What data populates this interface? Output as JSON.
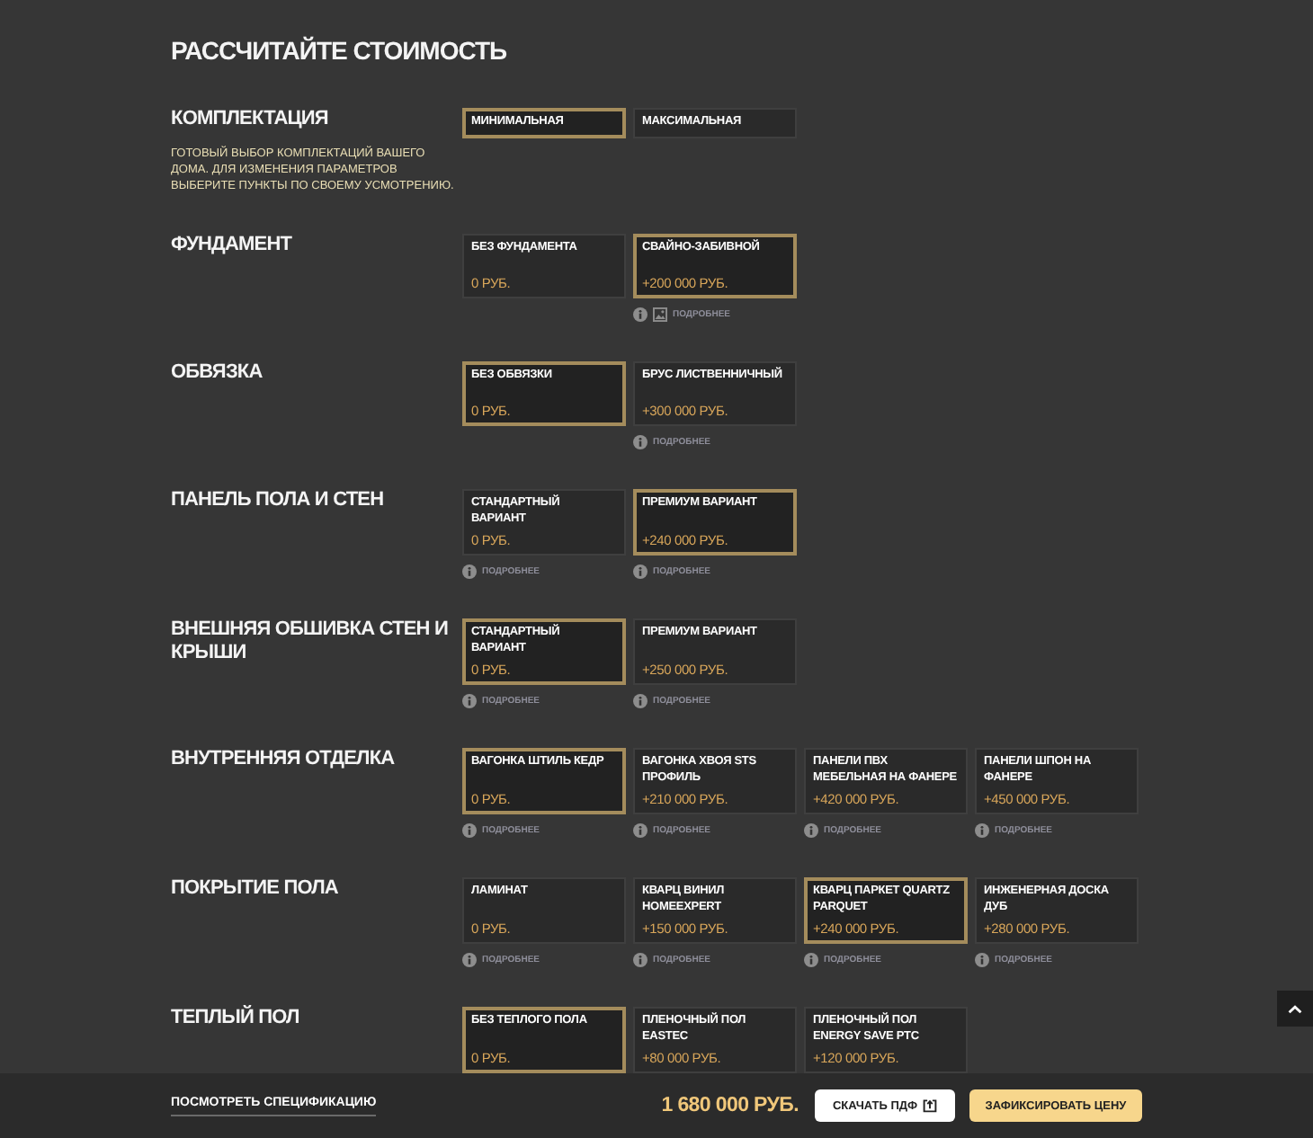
{
  "title": "РАССЧИТАЙТЕ СТОИМОСТЬ",
  "sections": [
    {
      "heading": "КОМПЛЕКТАЦИЯ",
      "description": "ГОТОВЫЙ ВЫБОР КОМПЛЕКТАЦИЙ ВАШЕГО ДОМА. ДЛЯ ИЗМЕНЕНИЯ ПАРАМЕТРОВ ВЫБЕРИТЕ ПУНКТЫ ПО СВОЕМУ УСМОТРЕНИЮ.",
      "options": [
        {
          "title": "МИНИМАЛЬНАЯ",
          "selected": true
        },
        {
          "title": "МАКСИМАЛЬНАЯ",
          "selected": false
        }
      ]
    },
    {
      "heading": "ФУНДАМЕНТ",
      "options": [
        {
          "title": "БЕЗ ФУНДАМЕНТА",
          "price": "0 РУБ.",
          "selected": false
        },
        {
          "title": "СВАЙНО-ЗАБИВНОЙ",
          "price": "+200 000 РУБ.",
          "selected": true,
          "details": "ПОДРОБНЕЕ",
          "has_photo": true
        }
      ]
    },
    {
      "heading": "ОБВЯЗКА",
      "options": [
        {
          "title": "БЕЗ ОБВЯЗКИ",
          "price": "0 РУБ.",
          "selected": true
        },
        {
          "title": "БРУС ЛИСТВЕННИЧНЫЙ",
          "price": "+300 000 РУБ.",
          "selected": false,
          "details": "ПОДРОБНЕЕ",
          "has_photo": false
        }
      ]
    },
    {
      "heading": "ПАНЕЛЬ ПОЛА И СТЕН",
      "options": [
        {
          "title": "СТАНДАРТНЫЙ ВАРИАНТ",
          "price": "0 РУБ.",
          "selected": false,
          "details": "ПОДРОБНЕЕ",
          "has_photo": false
        },
        {
          "title": "ПРЕМИУМ ВАРИАНТ",
          "price": "+240 000 РУБ.",
          "selected": true,
          "details": "ПОДРОБНЕЕ",
          "has_photo": false
        }
      ]
    },
    {
      "heading": "ВНЕШНЯЯ ОБШИВКА СТЕН И КРЫШИ",
      "options": [
        {
          "title": "СТАНДАРТНЫЙ ВАРИАНТ",
          "price": "0 РУБ.",
          "selected": true,
          "details": "ПОДРОБНЕЕ",
          "has_photo": false
        },
        {
          "title": "ПРЕМИУМ ВАРИАНТ",
          "price": "+250 000 РУБ.",
          "selected": false,
          "details": "ПОДРОБНЕЕ",
          "has_photo": false
        }
      ]
    },
    {
      "heading": "ВНУТРЕННЯЯ ОТДЕЛКА",
      "options": [
        {
          "title": "ВАГОНКА ШТИЛЬ КЕДР",
          "price": "0 РУБ.",
          "selected": true,
          "details": "ПОДРОБНЕЕ",
          "has_photo": false
        },
        {
          "title": "ВАГОНКА ХВОЯ STS ПРОФИЛЬ",
          "price": "+210 000 РУБ.",
          "selected": false,
          "details": "ПОДРОБНЕЕ",
          "has_photo": false
        },
        {
          "title": "ПАНЕЛИ ПВХ МЕБЕЛЬНАЯ НА ФАНЕРЕ",
          "price": "+420 000 РУБ.",
          "selected": false,
          "details": "ПОДРОБНЕЕ",
          "has_photo": false
        },
        {
          "title": "ПАНЕЛИ ШПОН НА ФАНЕРЕ",
          "price": "+450 000 РУБ.",
          "selected": false,
          "details": "ПОДРОБНЕЕ",
          "has_photo": false
        }
      ]
    },
    {
      "heading": "ПОКРЫТИЕ ПОЛА",
      "options": [
        {
          "title": "ЛАМИНАТ",
          "price": "0 РУБ.",
          "selected": false,
          "details": "ПОДРОБНЕЕ",
          "has_photo": false
        },
        {
          "title": "КВАРЦ ВИНИЛ HOMEEXPERT",
          "price": "+150 000 РУБ.",
          "selected": false,
          "details": "ПОДРОБНЕЕ",
          "has_photo": false
        },
        {
          "title": "КВАРЦ ПАРКЕТ QUARTZ PARQUET",
          "price": "+240 000 РУБ.",
          "selected": true,
          "details": "ПОДРОБНЕЕ",
          "has_photo": false
        },
        {
          "title": "ИНЖЕНЕРНАЯ ДОСКА ДУБ",
          "price": "+280 000 РУБ.",
          "selected": false,
          "details": "ПОДРОБНЕЕ",
          "has_photo": false
        }
      ]
    },
    {
      "heading": "ТЕПЛЫЙ ПОЛ",
      "options": [
        {
          "title": "БЕЗ ТЕПЛОГО ПОЛА",
          "price": "0 РУБ.",
          "selected": true
        },
        {
          "title": "ПЛЕНОЧНЫЙ ПОЛ EASTEC",
          "price": "+80 000 РУБ.",
          "selected": false
        },
        {
          "title": "ПЛЕНОЧНЫЙ ПОЛ ENERGY SAVE PTC",
          "price": "+120 000 РУБ.",
          "selected": false
        }
      ]
    }
  ],
  "footer": {
    "spec_link": "ПОСМОТРЕТЬ СПЕЦИФИКАЦИЮ",
    "total": "1 680 000 РУБ.",
    "download_button": "СКАЧАТЬ ПДФ",
    "fix_button": "ЗАФИКСИРОВАТЬ ЦЕНУ"
  }
}
